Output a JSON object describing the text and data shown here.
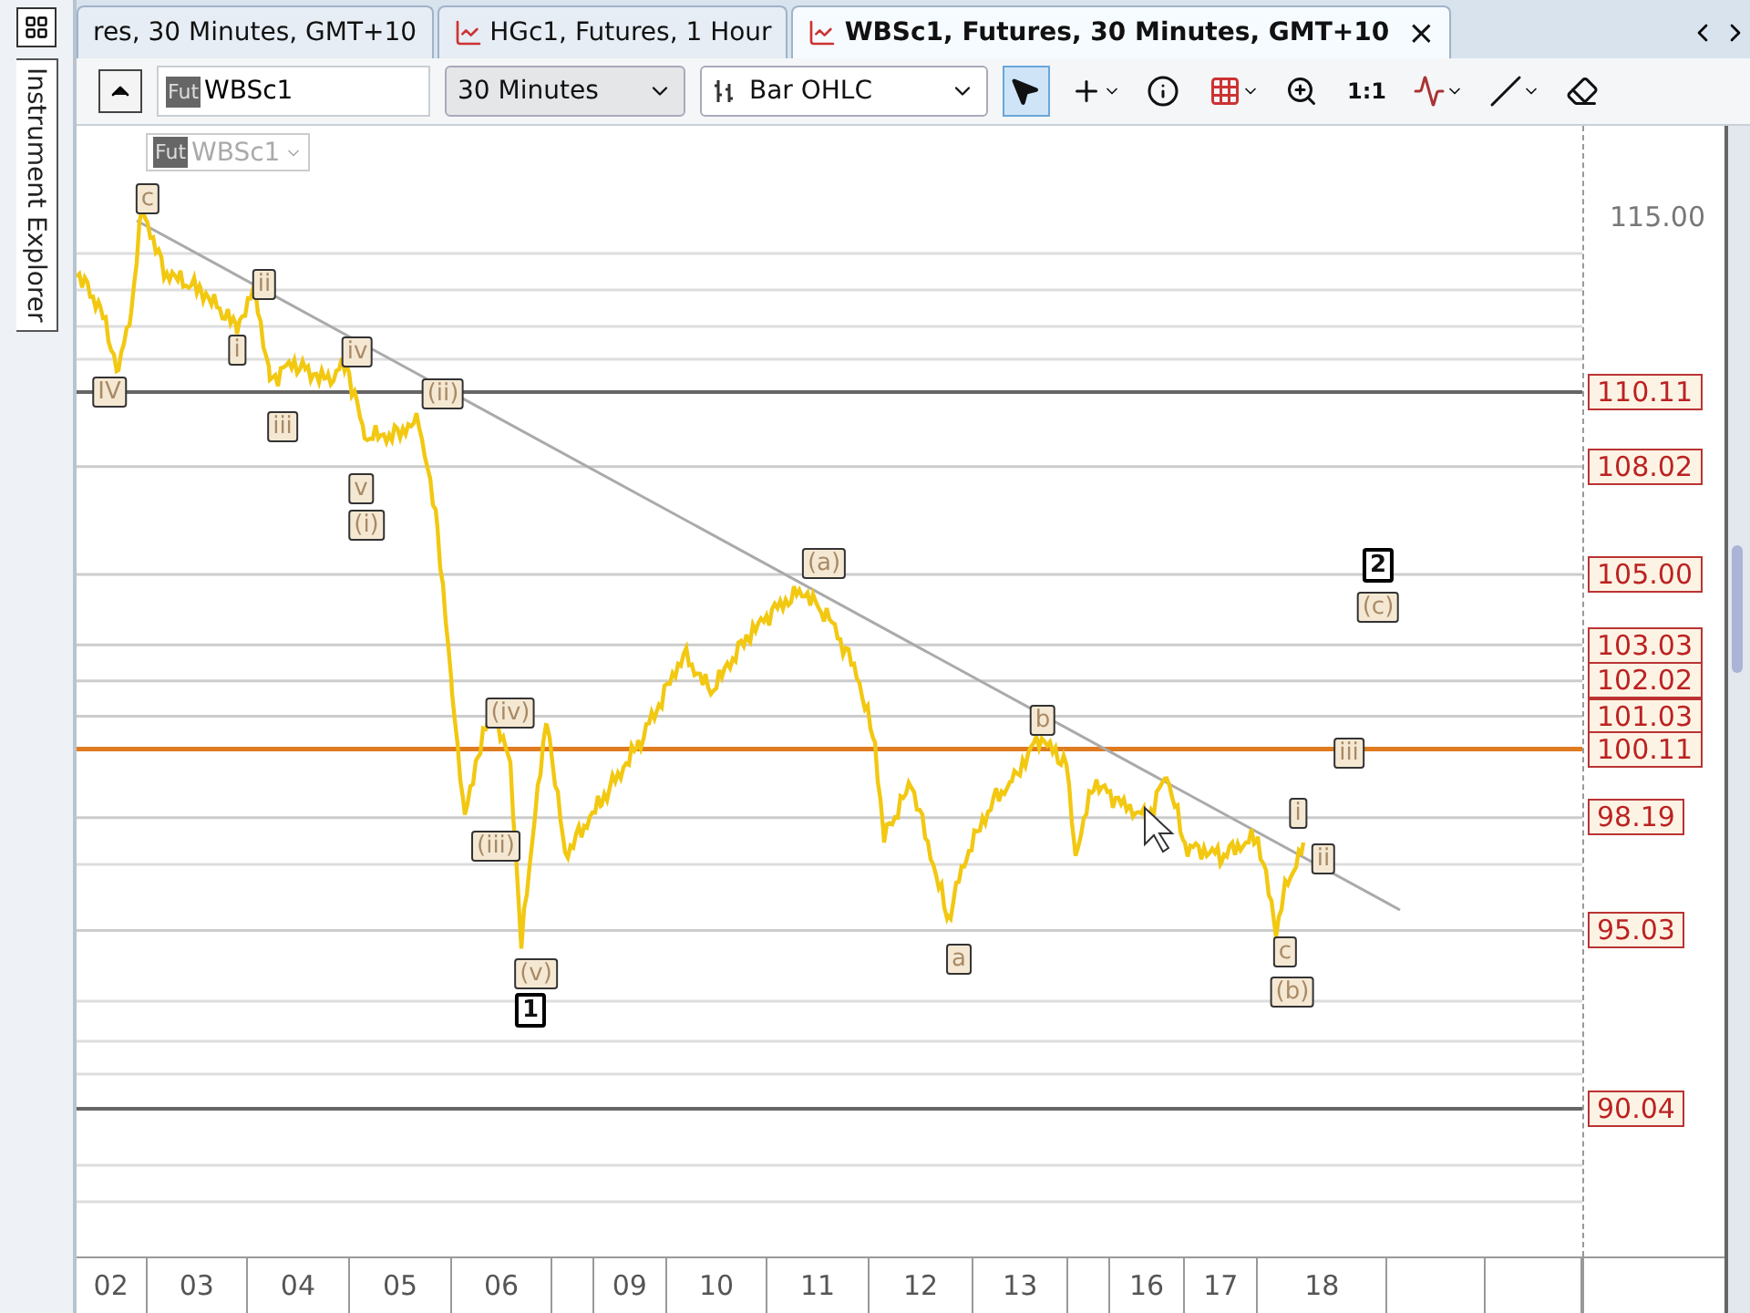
{
  "side_panel": {
    "title": "Instrument Explorer"
  },
  "tabs": [
    {
      "label": "res, 30 Minutes, GMT+10",
      "selected": false
    },
    {
      "label": "HGc1, Futures, 1 Hour",
      "selected": false
    },
    {
      "label": "WBSc1, Futures, 30 Minutes, GMT+10",
      "selected": true,
      "close": "×"
    }
  ],
  "toolbar": {
    "symbol_badge": "Fut",
    "symbol": "WBSc1",
    "interval": "30 Minutes",
    "chart_type": "Bar OHLC",
    "tools": [
      {
        "kind": "pointer",
        "selected": true
      },
      {
        "kind": "crosshair",
        "selected": false
      },
      {
        "kind": "info",
        "selected": false
      },
      {
        "kind": "grid",
        "selected": false
      },
      {
        "kind": "zoom",
        "selected": false
      },
      {
        "kind": "scale",
        "label": "1:1",
        "selected": false
      },
      {
        "kind": "wave",
        "selected": false
      },
      {
        "kind": "line",
        "selected": false
      },
      {
        "kind": "eraser",
        "selected": false
      }
    ]
  },
  "chart": {
    "legend": {
      "badge": "Fut",
      "symbol": "WBSc1"
    },
    "price_ticks": [
      "115.00"
    ],
    "levels": [
      {
        "label": "110.11",
        "kind": "major"
      },
      {
        "label": "108.02",
        "kind": "minor"
      },
      {
        "label": "105.00",
        "kind": "minor"
      },
      {
        "label": "103.03",
        "kind": "minor"
      },
      {
        "label": "102.02",
        "kind": "minor"
      },
      {
        "label": "101.03",
        "kind": "minor"
      },
      {
        "label": "100.11",
        "kind": "pivot"
      },
      {
        "label": "98.19",
        "kind": "minor"
      },
      {
        "label": "95.03",
        "kind": "minor"
      },
      {
        "label": "90.04",
        "kind": "major"
      }
    ],
    "wave_labels": [
      {
        "text": "c",
        "kind": "wave"
      },
      {
        "text": "IV",
        "kind": "wave"
      },
      {
        "text": "ii",
        "kind": "wave"
      },
      {
        "text": "i",
        "kind": "wave"
      },
      {
        "text": "iii",
        "kind": "wave"
      },
      {
        "text": "iv",
        "kind": "wave"
      },
      {
        "text": "(ii)",
        "kind": "wave"
      },
      {
        "text": "v",
        "kind": "wave"
      },
      {
        "text": "(i)",
        "kind": "wave"
      },
      {
        "text": "(iv)",
        "kind": "wave"
      },
      {
        "text": "(iii)",
        "kind": "wave"
      },
      {
        "text": "(v)",
        "kind": "wave"
      },
      {
        "text": "1",
        "kind": "count"
      },
      {
        "text": "(a)",
        "kind": "wave"
      },
      {
        "text": "b",
        "kind": "wave"
      },
      {
        "text": "a",
        "kind": "wave"
      },
      {
        "text": "iii",
        "kind": "wave"
      },
      {
        "text": "i",
        "kind": "wave"
      },
      {
        "text": "ii",
        "kind": "wave"
      },
      {
        "text": "c",
        "kind": "wave"
      },
      {
        "text": "(b)",
        "kind": "wave"
      },
      {
        "text": "2",
        "kind": "count"
      },
      {
        "text": "(c)",
        "kind": "wave"
      }
    ],
    "x_axis": [
      "02",
      "03",
      "04",
      "05",
      "06",
      "09",
      "10",
      "11",
      "12",
      "13",
      "16",
      "17",
      "18"
    ]
  }
}
